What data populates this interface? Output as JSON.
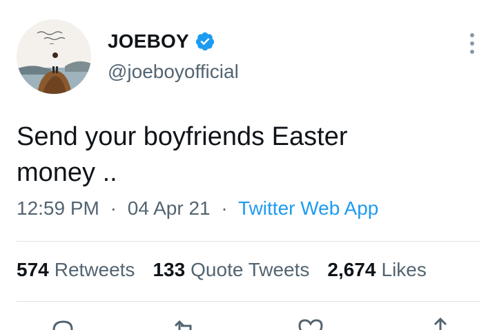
{
  "tweet": {
    "display_name": "JOEBOY",
    "handle": "@joeboyofficial",
    "text_line1": "Send your boyfriends Easter",
    "text_line2": "money ..",
    "time": "12:59 PM",
    "date": "04 Apr 21",
    "source": "Twitter Web App",
    "separator": "·"
  },
  "stats": {
    "retweets_count": "574",
    "retweets_label": "Retweets",
    "quotes_count": "133",
    "quotes_label": "Quote Tweets",
    "likes_count": "2,674",
    "likes_label": "Likes"
  },
  "icons": {
    "verified": "verified-badge-icon",
    "more": "more-options-icon",
    "reply": "reply-icon",
    "retweet": "retweet-icon",
    "like": "like-icon",
    "share": "share-icon"
  },
  "colors": {
    "accent": "#1d9bf0",
    "text": "#0f1419",
    "muted": "#536471",
    "divider": "#dfe3e6"
  }
}
